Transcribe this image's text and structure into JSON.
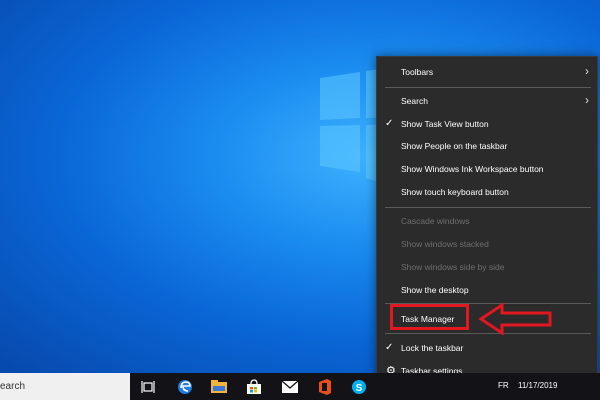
{
  "context_menu": {
    "items": [
      {
        "label": "Toolbars",
        "submenu": true
      },
      {
        "label": "Search",
        "submenu": true
      },
      {
        "label": "Show Task View button",
        "checked": true
      },
      {
        "label": "Show People on the taskbar"
      },
      {
        "label": "Show Windows Ink Workspace button"
      },
      {
        "label": "Show touch keyboard button"
      },
      {
        "label": "Cascade windows",
        "disabled": true
      },
      {
        "label": "Show windows stacked",
        "disabled": true
      },
      {
        "label": "Show windows side by side",
        "disabled": true
      },
      {
        "label": "Show the desktop"
      },
      {
        "label": "Task Manager",
        "highlighted": true
      },
      {
        "label": "Lock the taskbar",
        "checked": true
      },
      {
        "label": "Taskbar settings",
        "icon": "gear-icon"
      }
    ]
  },
  "taskbar": {
    "search_text": "earch",
    "icons": [
      "task-view-icon",
      "edge-icon",
      "file-explorer-icon",
      "store-icon",
      "mail-icon",
      "office-icon",
      "skype-icon"
    ],
    "language": "FR",
    "date": "11/17/2019"
  },
  "colors": {
    "menu_bg": "#2b2b2b",
    "highlight": "#e3171f",
    "taskbar_bg": "#131317",
    "desktop_blue": "#0a66d6"
  }
}
